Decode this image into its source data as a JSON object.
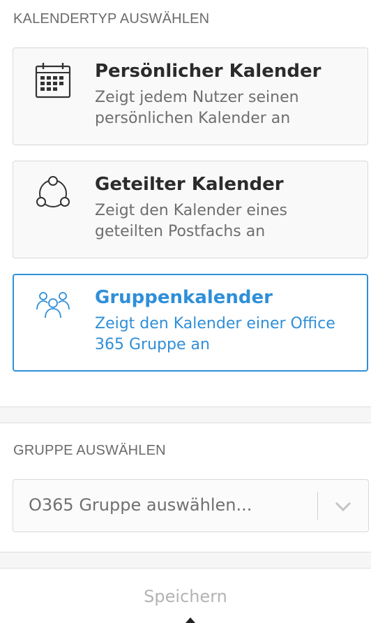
{
  "calendar_type": {
    "heading": "KALENDERTYP AUSWÄHLEN",
    "options": [
      {
        "icon": "calendar-icon",
        "title": "Persönlicher Kalender",
        "description": "Zeigt jedem Nutzer seinen persönlichen Kalender an",
        "selected": false
      },
      {
        "icon": "shared-network-icon",
        "title": "Geteilter Kalender",
        "description": "Zeigt den Kalender eines geteilten Postfachs an",
        "selected": false
      },
      {
        "icon": "group-icon",
        "title": "Gruppenkalender",
        "description": "Zeigt den Kalender einer Office 365 Gruppe an",
        "selected": true
      }
    ]
  },
  "group_select": {
    "heading": "GRUPPE AUSWÄHLEN",
    "placeholder": "O365 Gruppe auswählen...",
    "icon": "chevron-down-icon"
  },
  "footer": {
    "save_label": "Speichern"
  },
  "colors": {
    "accent": "#2f8fd8",
    "text": "#2b2b2b",
    "muted": "#6e6e6e",
    "border": "#d9d9d9",
    "disabled": "#b3b3b3"
  }
}
